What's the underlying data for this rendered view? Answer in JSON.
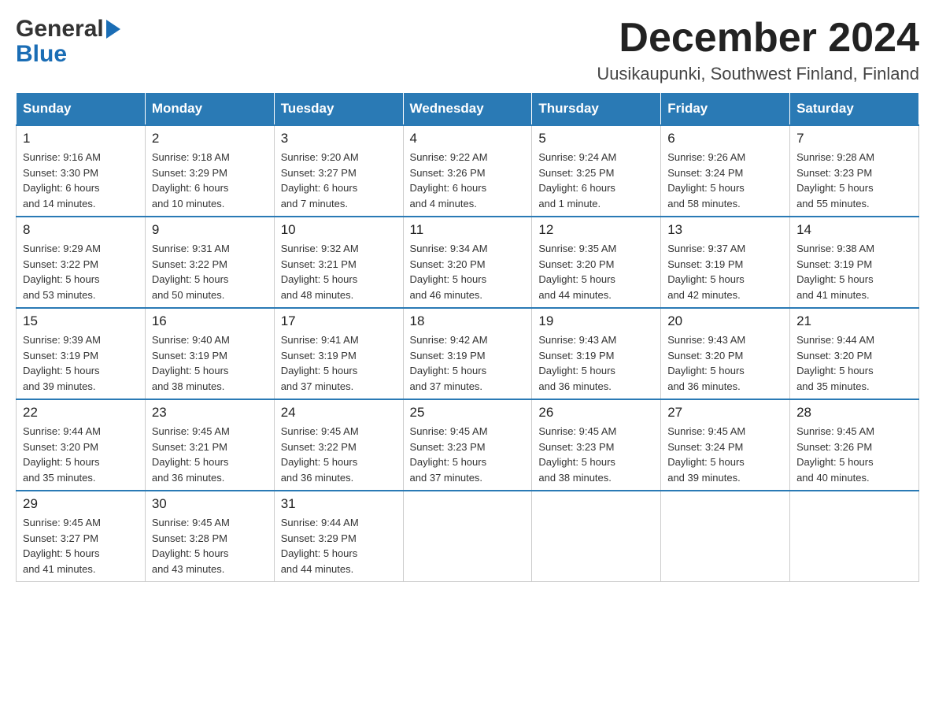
{
  "header": {
    "logo_general": "General",
    "logo_blue": "Blue",
    "month_title": "December 2024",
    "location": "Uusikaupunki, Southwest Finland, Finland"
  },
  "days_of_week": [
    "Sunday",
    "Monday",
    "Tuesday",
    "Wednesday",
    "Thursday",
    "Friday",
    "Saturday"
  ],
  "weeks": [
    [
      {
        "day": "1",
        "sunrise": "9:16 AM",
        "sunset": "3:30 PM",
        "daylight": "6 hours and 14 minutes."
      },
      {
        "day": "2",
        "sunrise": "9:18 AM",
        "sunset": "3:29 PM",
        "daylight": "6 hours and 10 minutes."
      },
      {
        "day": "3",
        "sunrise": "9:20 AM",
        "sunset": "3:27 PM",
        "daylight": "6 hours and 7 minutes."
      },
      {
        "day": "4",
        "sunrise": "9:22 AM",
        "sunset": "3:26 PM",
        "daylight": "6 hours and 4 minutes."
      },
      {
        "day": "5",
        "sunrise": "9:24 AM",
        "sunset": "3:25 PM",
        "daylight": "6 hours and 1 minute."
      },
      {
        "day": "6",
        "sunrise": "9:26 AM",
        "sunset": "3:24 PM",
        "daylight": "5 hours and 58 minutes."
      },
      {
        "day": "7",
        "sunrise": "9:28 AM",
        "sunset": "3:23 PM",
        "daylight": "5 hours and 55 minutes."
      }
    ],
    [
      {
        "day": "8",
        "sunrise": "9:29 AM",
        "sunset": "3:22 PM",
        "daylight": "5 hours and 53 minutes."
      },
      {
        "day": "9",
        "sunrise": "9:31 AM",
        "sunset": "3:22 PM",
        "daylight": "5 hours and 50 minutes."
      },
      {
        "day": "10",
        "sunrise": "9:32 AM",
        "sunset": "3:21 PM",
        "daylight": "5 hours and 48 minutes."
      },
      {
        "day": "11",
        "sunrise": "9:34 AM",
        "sunset": "3:20 PM",
        "daylight": "5 hours and 46 minutes."
      },
      {
        "day": "12",
        "sunrise": "9:35 AM",
        "sunset": "3:20 PM",
        "daylight": "5 hours and 44 minutes."
      },
      {
        "day": "13",
        "sunrise": "9:37 AM",
        "sunset": "3:19 PM",
        "daylight": "5 hours and 42 minutes."
      },
      {
        "day": "14",
        "sunrise": "9:38 AM",
        "sunset": "3:19 PM",
        "daylight": "5 hours and 41 minutes."
      }
    ],
    [
      {
        "day": "15",
        "sunrise": "9:39 AM",
        "sunset": "3:19 PM",
        "daylight": "5 hours and 39 minutes."
      },
      {
        "day": "16",
        "sunrise": "9:40 AM",
        "sunset": "3:19 PM",
        "daylight": "5 hours and 38 minutes."
      },
      {
        "day": "17",
        "sunrise": "9:41 AM",
        "sunset": "3:19 PM",
        "daylight": "5 hours and 37 minutes."
      },
      {
        "day": "18",
        "sunrise": "9:42 AM",
        "sunset": "3:19 PM",
        "daylight": "5 hours and 37 minutes."
      },
      {
        "day": "19",
        "sunrise": "9:43 AM",
        "sunset": "3:19 PM",
        "daylight": "5 hours and 36 minutes."
      },
      {
        "day": "20",
        "sunrise": "9:43 AM",
        "sunset": "3:20 PM",
        "daylight": "5 hours and 36 minutes."
      },
      {
        "day": "21",
        "sunrise": "9:44 AM",
        "sunset": "3:20 PM",
        "daylight": "5 hours and 35 minutes."
      }
    ],
    [
      {
        "day": "22",
        "sunrise": "9:44 AM",
        "sunset": "3:20 PM",
        "daylight": "5 hours and 35 minutes."
      },
      {
        "day": "23",
        "sunrise": "9:45 AM",
        "sunset": "3:21 PM",
        "daylight": "5 hours and 36 minutes."
      },
      {
        "day": "24",
        "sunrise": "9:45 AM",
        "sunset": "3:22 PM",
        "daylight": "5 hours and 36 minutes."
      },
      {
        "day": "25",
        "sunrise": "9:45 AM",
        "sunset": "3:23 PM",
        "daylight": "5 hours and 37 minutes."
      },
      {
        "day": "26",
        "sunrise": "9:45 AM",
        "sunset": "3:23 PM",
        "daylight": "5 hours and 38 minutes."
      },
      {
        "day": "27",
        "sunrise": "9:45 AM",
        "sunset": "3:24 PM",
        "daylight": "5 hours and 39 minutes."
      },
      {
        "day": "28",
        "sunrise": "9:45 AM",
        "sunset": "3:26 PM",
        "daylight": "5 hours and 40 minutes."
      }
    ],
    [
      {
        "day": "29",
        "sunrise": "9:45 AM",
        "sunset": "3:27 PM",
        "daylight": "5 hours and 41 minutes."
      },
      {
        "day": "30",
        "sunrise": "9:45 AM",
        "sunset": "3:28 PM",
        "daylight": "5 hours and 43 minutes."
      },
      {
        "day": "31",
        "sunrise": "9:44 AM",
        "sunset": "3:29 PM",
        "daylight": "5 hours and 44 minutes."
      },
      null,
      null,
      null,
      null
    ]
  ],
  "labels": {
    "sunrise": "Sunrise:",
    "sunset": "Sunset:",
    "daylight": "Daylight:"
  }
}
